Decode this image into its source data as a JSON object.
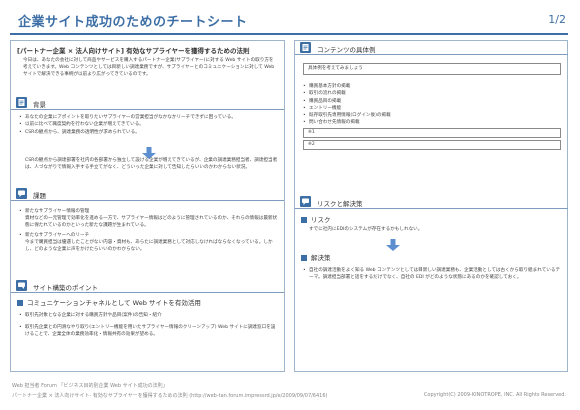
{
  "header": {
    "title": "企業サイト成功のためのチートシート",
    "page": "1/2"
  },
  "intro": {
    "title": "[パートナー企業 × 法人向けサイト] 有効なサプライヤーを獲得するための法則",
    "body": "今日は、あなたの会社に対して商品やサービスを購入するパートナー企業(サプライヤー)に対する Web サイトの取り方を考えていきます。Web コンテンツとしては目新しい調達業務ですが、サプライヤーとのコミュニケーションに対して Web サイトで解決できる事柄が以前より広がってきているのです。"
  },
  "background": {
    "label": "背景",
    "items": [
      "あなたの企業にアポイントを取りたいサプライヤーの営業担当がなかなかリーチできずに困っている。",
      "以前に比べて職度契約を行わない企業が増えてきている。",
      "CSRの観点から、調達業務の透明性が求められている。"
    ],
    "result": "CSRの観点から調達部署を社内の各部署から独立して設ける企業が増えてきているが、企業の調達業務担当者、調達担当者は、人づながりで情報入手する手立てがなく、どういった企業に対して告知したらいいのかわからない状況。"
  },
  "issues": {
    "label": "課題",
    "items": [
      {
        "title": "新たなサプライヤー情報の管理",
        "desc": "資材などの一元管理で効率化を進める一方で、サプライヤー情報はどのように管理されているのか、それらの情報は最新状態に保たれているのかといった新たな課題が生まれている。"
      },
      {
        "title": "新たなサプライヤーへのリーチ",
        "desc": "今まで購買担当は優遇したことがない内容・資材も、あらたに調達業務として対応しなければならなくなっている。しかし、どのような企業に声をかけたらいいのかわからない。"
      }
    ]
  },
  "points": {
    "label": "サイト構築のポイント",
    "sub": "コミュニケーションチャネルとして Web サイトを有効活用",
    "items": [
      "取引先対象となる企業に対する購買方針や品目(案件)の告知・紹介",
      "取引先企業との円滑なやり取り(エントリー機能を用いたサプライヤー情報のクリーンアップ) Web サイトに調達窓口を設けることで、企業全体の業務効率化・情報共有の効果が望める。"
    ]
  },
  "contents": {
    "label": "コンテンツの具体例",
    "example": "具体例を考えてみましょう",
    "items": [
      "購買基本方針の掲載",
      "取引の流れの掲載",
      "購買品目の掲載",
      "エントリー機能",
      "既存取引先専用情報(ログイン後)の掲載",
      "問い合わせ先情報の掲載"
    ],
    "notes": [
      "※1",
      "※2"
    ]
  },
  "risk": {
    "label": "リスクと解決策",
    "risk_title": "リスク",
    "risk_text": "すでに社内にEDIのシステムが存在するかもしれない。",
    "solution_title": "解決策",
    "solution_items": [
      "自社の調達活動をよく知る Web コンテンツとしては目新しい調達業務も、企業活動としては古くから取り組まれているテーマ。調達担当部署と話をするだけでなく、自社の EDI がどのような状態にあるのかを確認しておく。"
    ]
  },
  "footer": {
    "line1": "Web 担当者 Forum 「ビジネス目的別企業 Web サイト成功の法則」",
    "line2": "パートナー企業 × 法人向けサイト- 有効なサプライヤーを獲得するための法則 (http://web-tan.forum.impressrd.jp/e/2009/09/07/6416)",
    "copyright": "Copyright(C) 2009-KINOTROPE, INC. All Rights Reserved."
  },
  "colors": {
    "accent": "#3d6fa6",
    "arrow": "#5b8fcf",
    "border": "#9fb5cc"
  }
}
